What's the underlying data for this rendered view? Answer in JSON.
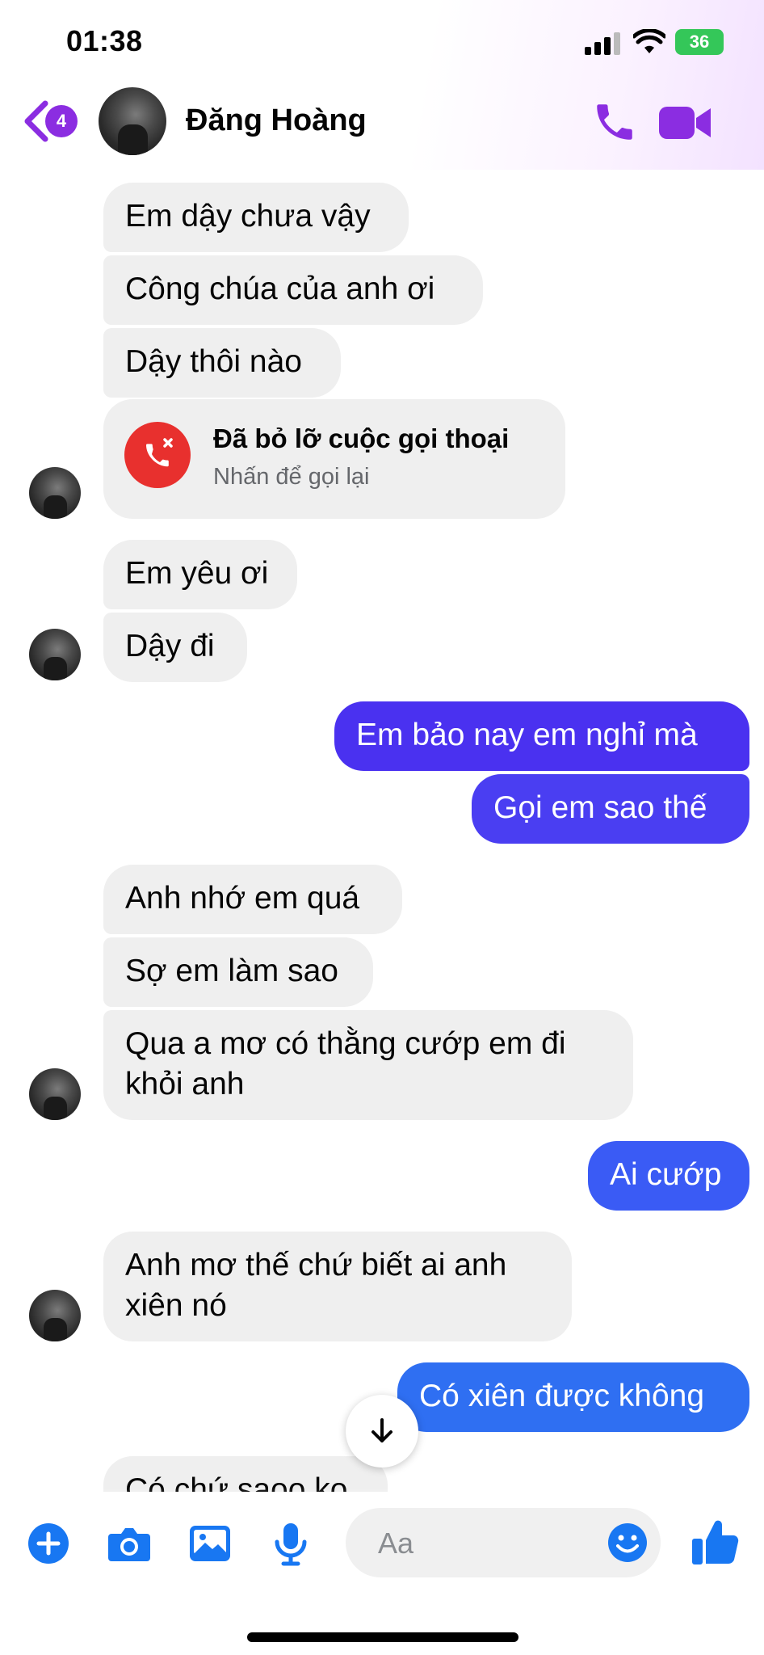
{
  "status_bar": {
    "time": "01:38",
    "battery": "36"
  },
  "header": {
    "back_badge_count": "4",
    "contact_name": "Đăng Hoàng"
  },
  "messages": [
    {
      "text": "Em dậy chưa vậy"
    },
    {
      "text": "Công chúa của anh ơi"
    },
    {
      "text": "Dậy thôi nào"
    },
    {
      "missed_call_title": "Đã bỏ lỡ cuộc gọi thoại",
      "missed_call_subtitle": "Nhấn để gọi lại"
    },
    {
      "text": "Em yêu ơi"
    },
    {
      "text": "Dậy đi"
    },
    {
      "text": "Em bảo nay em nghỉ mà"
    },
    {
      "text": "Gọi em sao thế"
    },
    {
      "text": "Anh nhớ em quá"
    },
    {
      "text": "Sợ em làm sao"
    },
    {
      "text": "Qua a mơ có thằng cướp em đi khỏi anh"
    },
    {
      "text": "Ai cướp"
    },
    {
      "text": "Anh mơ thế chứ biết ai anh xiên nó"
    },
    {
      "text": "Có xiên được không"
    },
    {
      "text": "Có chứ saoo ko"
    }
  ],
  "composer": {
    "placeholder": "Aa"
  },
  "colors": {
    "accent_purple": "#8b2de1",
    "outgoing_bubble": "#4a31f0",
    "incoming_bubble": "#efefef",
    "missed_call_red": "#e8302e",
    "toolbar_blue": "#1877f2"
  },
  "icons": [
    "back-chevron-icon",
    "phone-icon",
    "video-camera-icon",
    "missed-call-icon",
    "arrow-down-icon",
    "plus-icon",
    "camera-icon",
    "image-icon",
    "microphone-icon",
    "emoji-icon",
    "thumbs-up-icon"
  ]
}
